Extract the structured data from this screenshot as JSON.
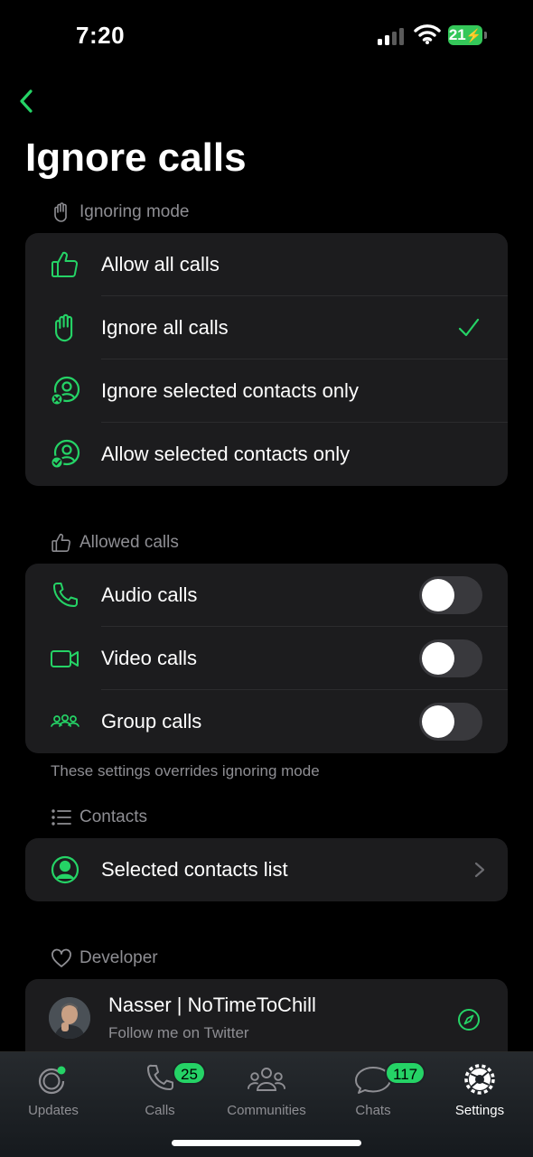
{
  "status_bar": {
    "time": "7:20",
    "battery": "21"
  },
  "page": {
    "title": "Ignore calls"
  },
  "ignoring_mode": {
    "header": "Ignoring mode",
    "items": [
      {
        "label": "Allow all calls",
        "icon": "thumbs-up-icon"
      },
      {
        "label": "Ignore all calls",
        "icon": "hand-icon",
        "selected": true
      },
      {
        "label": "Ignore selected contacts only",
        "icon": "contact-blocked-icon"
      },
      {
        "label": "Allow selected contacts only",
        "icon": "contact-allowed-icon"
      }
    ]
  },
  "allowed_calls": {
    "header": "Allowed calls",
    "items": [
      {
        "label": "Audio calls",
        "icon": "phone-icon",
        "enabled": false
      },
      {
        "label": "Video calls",
        "icon": "video-icon",
        "enabled": false
      },
      {
        "label": "Group calls",
        "icon": "group-icon",
        "enabled": false
      }
    ],
    "footnote": "These settings overrides ignoring mode"
  },
  "contacts": {
    "header": "Contacts",
    "items": [
      {
        "label": "Selected contacts list",
        "icon": "contact-icon"
      }
    ]
  },
  "developer": {
    "header": "Developer",
    "name": "Nasser | NoTimeToChill",
    "subtitle": "Follow me on Twitter"
  },
  "tab_bar": {
    "tabs": [
      {
        "label": "Updates",
        "icon": "updates-icon"
      },
      {
        "label": "Calls",
        "icon": "phone-icon",
        "badge": "25"
      },
      {
        "label": "Communities",
        "icon": "communities-icon"
      },
      {
        "label": "Chats",
        "icon": "chats-icon",
        "badge": "117"
      },
      {
        "label": "Settings",
        "icon": "settings-icon",
        "active": true
      }
    ]
  },
  "colors": {
    "accent": "#25d366",
    "background": "#000000",
    "card": "#1c1c1e",
    "secondary_text": "#8e8e93"
  }
}
